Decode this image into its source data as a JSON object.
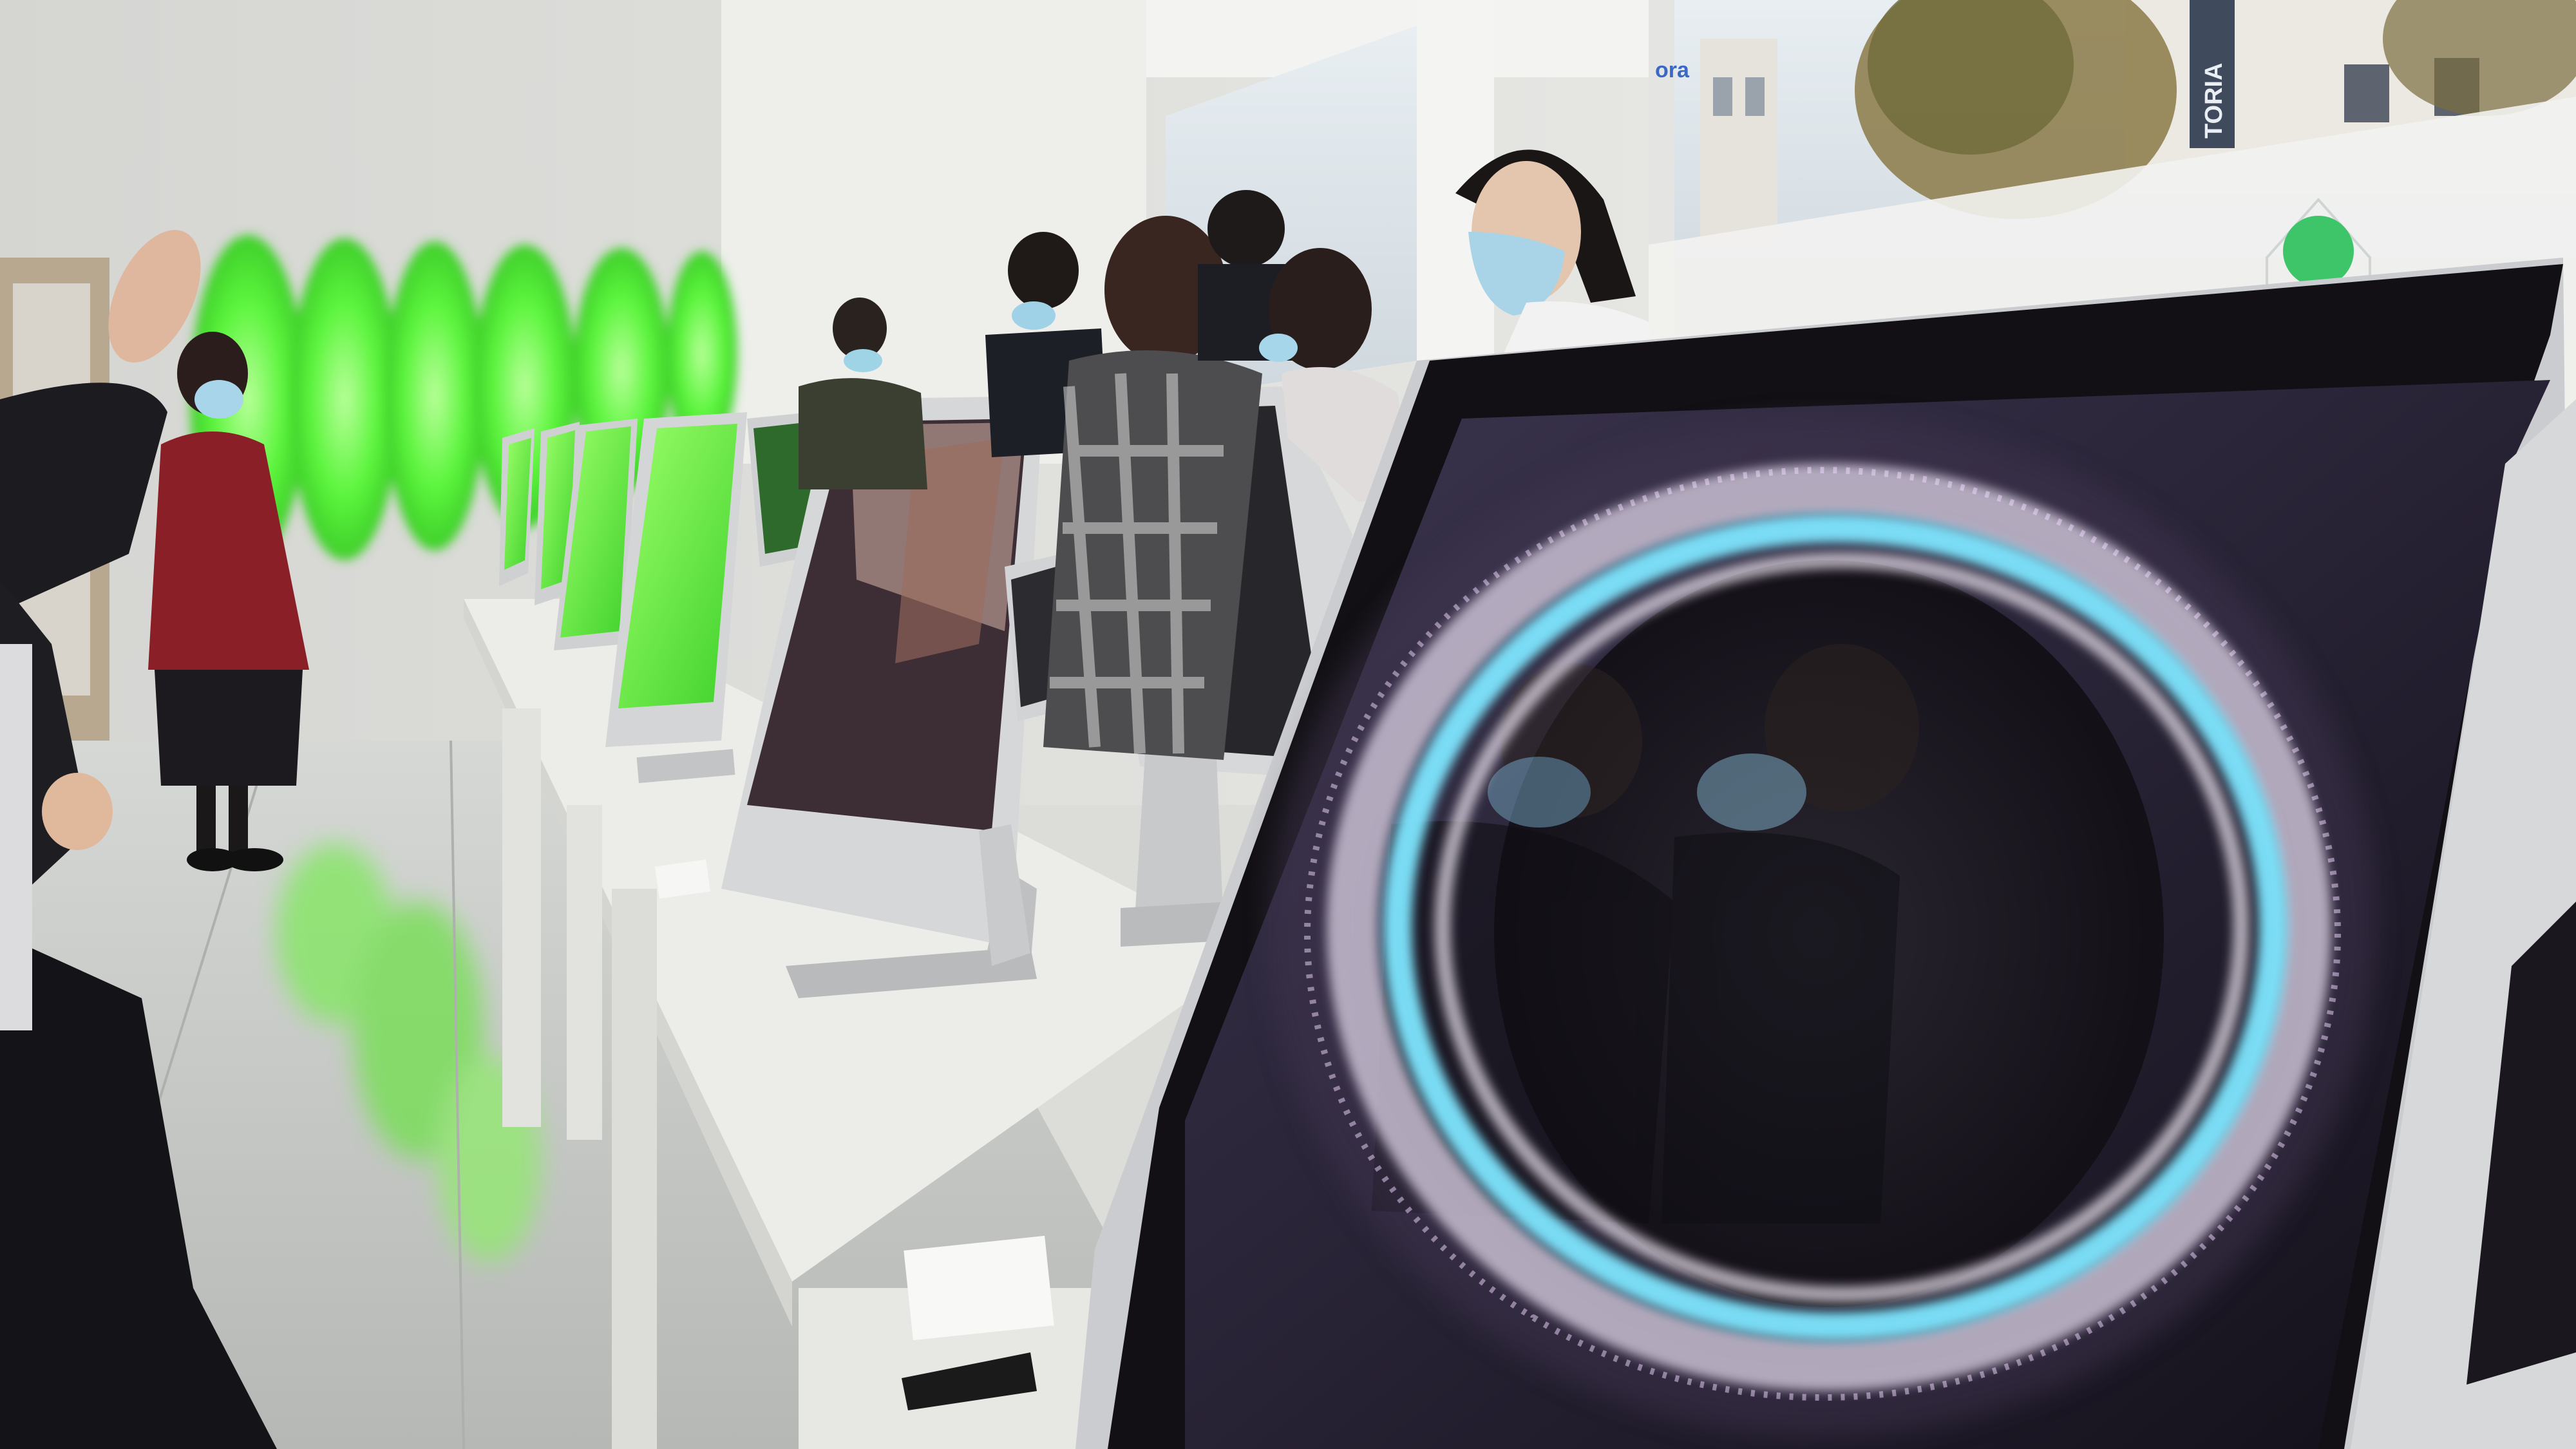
{
  "scene": {
    "type": "photograph",
    "colors": {
      "wall": "#e9e9e6",
      "floor": "#c9cbc9",
      "table": "#ecece9",
      "green_light": "#54ff3a",
      "screen_dark": "#1a1620",
      "ring_cyan": "#7fe6ff",
      "monitor_silver": "#cfd0d2"
    },
    "street_sign_text": "TORIA",
    "window_sign_partial": "ora"
  }
}
